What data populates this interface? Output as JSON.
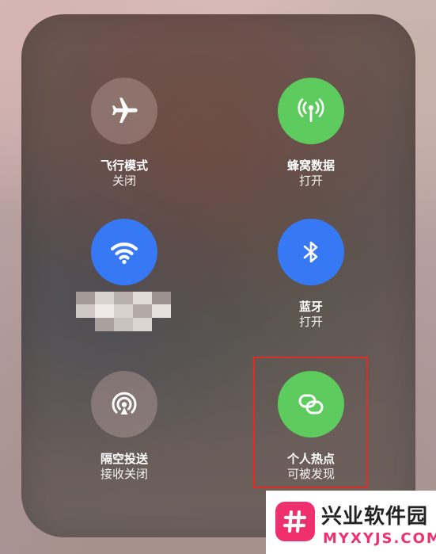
{
  "controls": {
    "airplane": {
      "label": "飞行模式",
      "status": "关闭",
      "icon": "airplane-icon",
      "color": "#cdb4af"
    },
    "cellular": {
      "label": "蜂窝数据",
      "status": "打开",
      "icon": "antenna-icon",
      "color": "#5ecb5f"
    },
    "wifi": {
      "label": "",
      "status": "",
      "icon": "wifi-icon",
      "color": "#3779f5"
    },
    "bluetooth": {
      "label": "蓝牙",
      "status": "打开",
      "icon": "bluetooth-icon",
      "color": "#3779f5"
    },
    "airdrop": {
      "label": "隔空投送",
      "status": "接收关闭",
      "icon": "airdrop-icon",
      "color": "#cdb4af"
    },
    "hotspot": {
      "label": "个人热点",
      "status": "可被发现",
      "icon": "hotspot-link-icon",
      "color": "#5ecb5f"
    }
  },
  "highlight_color": "#e02b2b",
  "watermark": {
    "title": "兴业软件园",
    "subtitle": "MYXYJS.COM",
    "accent": "#f02f6e"
  }
}
